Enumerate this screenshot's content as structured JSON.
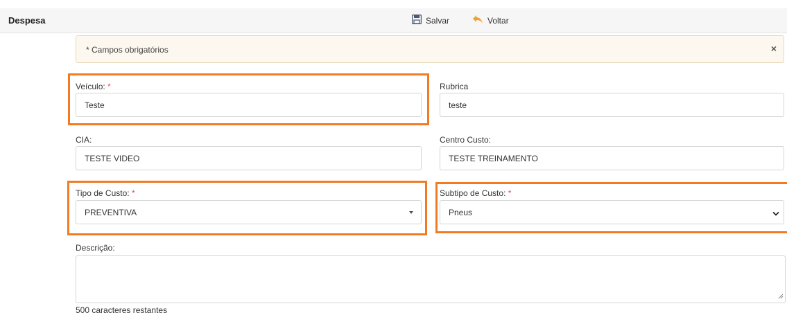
{
  "header": {
    "title": "Despesa",
    "save_label": "Salvar",
    "back_label": "Voltar"
  },
  "alert": {
    "text": "* Campos obrigatórios",
    "close_symbol": "×"
  },
  "form": {
    "required_mark": "*",
    "veiculo": {
      "label": "Veículo:",
      "value": "Teste"
    },
    "rubrica": {
      "label": "Rubrica",
      "value": "teste"
    },
    "cia": {
      "label": "CIA:",
      "value": "TESTE VIDEO"
    },
    "centro_custo": {
      "label": "Centro Custo:",
      "value": "TESTE TREINAMENTO"
    },
    "tipo_custo": {
      "label": "Tipo de Custo:",
      "value": "PREVENTIVA"
    },
    "subtipo_custo": {
      "label": "Subtipo de Custo:",
      "value": "Pneus"
    },
    "descricao": {
      "label": "Descrição:",
      "value": ""
    },
    "chars_remaining": "500 caracteres restantes"
  },
  "colors": {
    "highlight": "#f27b21",
    "required": "#d9534f",
    "save_icon": "#4a5a73",
    "back_icon": "#f0a030"
  },
  "icons": {
    "save": "floppy-disk-icon",
    "back": "reply-arrow-icon"
  }
}
